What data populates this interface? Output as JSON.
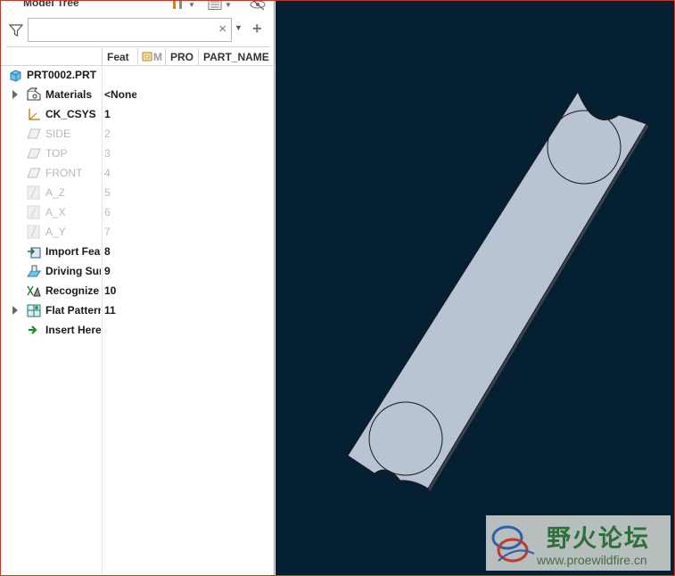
{
  "panel": {
    "title": "Model Tree",
    "search": {
      "value": "",
      "placeholder": "",
      "clear_glyph": "×",
      "add_glyph": "+"
    }
  },
  "columns": [
    {
      "label": "Feat"
    },
    {
      "label": "M"
    },
    {
      "label": "PRO"
    },
    {
      "label": "PART_NAME"
    }
  ],
  "root": {
    "label": "PRT0002.PRT",
    "icon": "part-icon"
  },
  "rows": [
    {
      "label": "Materials",
      "num": "<None",
      "icon": "materials-icon",
      "expandable": true,
      "dim": false
    },
    {
      "label": "CK_CSYS",
      "num": "1",
      "icon": "csys-icon",
      "expandable": false,
      "dim": false
    },
    {
      "label": "SIDE",
      "num": "2",
      "icon": "datum-plane-icon",
      "expandable": false,
      "dim": true
    },
    {
      "label": "TOP",
      "num": "3",
      "icon": "datum-plane-icon",
      "expandable": false,
      "dim": true
    },
    {
      "label": "FRONT",
      "num": "4",
      "icon": "datum-plane-icon",
      "expandable": false,
      "dim": true
    },
    {
      "label": "A_Z",
      "num": "5",
      "icon": "datum-axis-icon",
      "expandable": false,
      "dim": true
    },
    {
      "label": "A_X",
      "num": "6",
      "icon": "datum-axis-icon",
      "expandable": false,
      "dim": true
    },
    {
      "label": "A_Y",
      "num": "7",
      "icon": "datum-axis-icon",
      "expandable": false,
      "dim": true
    },
    {
      "label": "Import Feat",
      "num": "8",
      "icon": "import-feature-icon",
      "expandable": false,
      "dim": false
    },
    {
      "label": "Driving Sur",
      "num": "9",
      "icon": "driving-surface-icon",
      "expandable": false,
      "dim": false
    },
    {
      "label": "Recognize",
      "num": "10",
      "icon": "recognize-icon",
      "expandable": false,
      "dim": false
    },
    {
      "label": "Flat Pattern",
      "num": "11",
      "icon": "flat-pattern-icon",
      "expandable": true,
      "dim": false
    },
    {
      "label": "Insert Here",
      "num": "",
      "icon": "insert-here-arrow-icon",
      "expandable": false,
      "dim": false
    }
  ],
  "graphics": {
    "background": "#062033",
    "part_fill": "#b8c4d4",
    "part_edge": "#1a1a1a"
  },
  "watermark": {
    "cn_text": "野火论坛",
    "url": "www.proewildfire.cn"
  }
}
